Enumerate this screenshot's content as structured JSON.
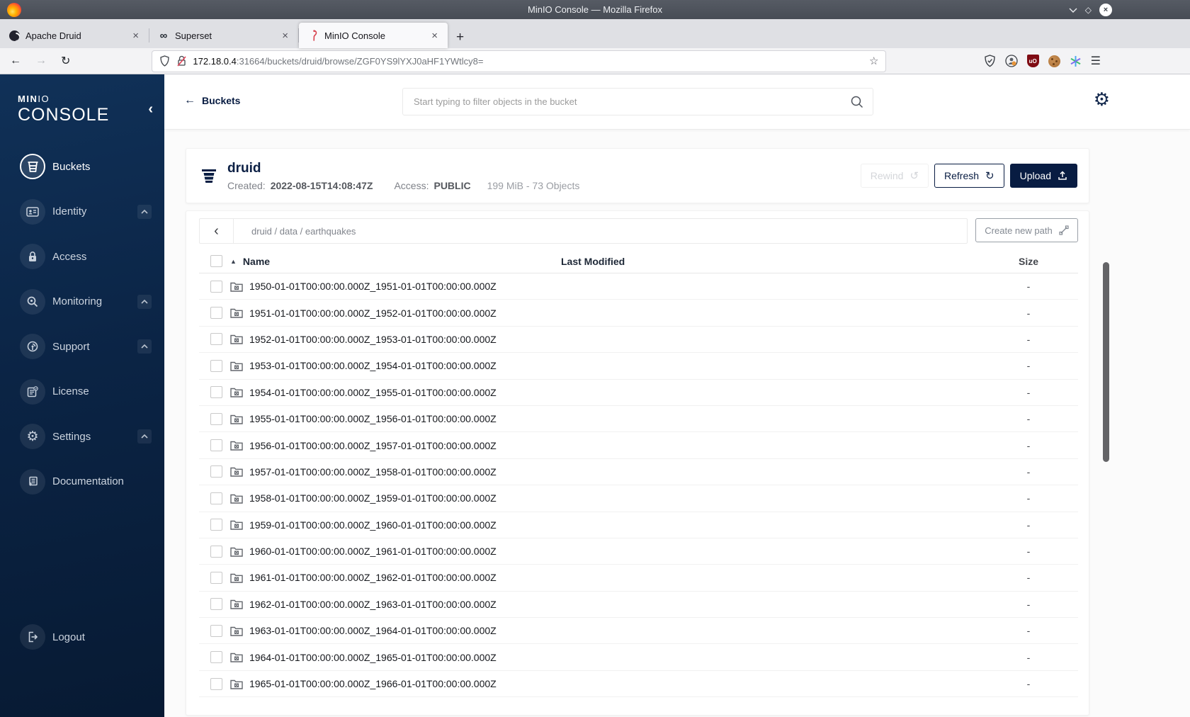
{
  "browser": {
    "window_title": "MinIO Console — Mozilla Firefox",
    "tabs": [
      {
        "label": "Apache Druid"
      },
      {
        "label": "Superset"
      },
      {
        "label": "MinIO Console"
      }
    ],
    "url_host": "172.18.0.4",
    "url_rest": ":31664/buckets/druid/browse/ZGF0YS9lYXJ0aHF1YWtlcy8="
  },
  "icons": {
    "close": "×",
    "maximize": "◇",
    "back_arrow": "←",
    "forward_arrow": "→",
    "reload": "↻",
    "star": "☆",
    "menu": "☰",
    "infinity": "∞",
    "new_tab": "+",
    "chevron_left": "‹",
    "gear": "⚙",
    "sort_asc": "▲",
    "refresh": "↻",
    "rewind": "↺"
  },
  "sidebar": {
    "logo_min": "MIN",
    "logo_io": "IO",
    "logo_console": "CONSOLE",
    "items": [
      {
        "label": "Buckets"
      },
      {
        "label": "Identity"
      },
      {
        "label": "Access"
      },
      {
        "label": "Monitoring"
      },
      {
        "label": "Support"
      },
      {
        "label": "License"
      },
      {
        "label": "Settings"
      },
      {
        "label": "Documentation"
      }
    ],
    "logout_label": "Logout"
  },
  "header": {
    "back_label": "Buckets",
    "search_placeholder": "Start typing to filter objects in the bucket"
  },
  "bucket": {
    "name": "druid",
    "created_label": "Created:",
    "created_value": "2022-08-15T14:08:47Z",
    "access_label": "Access:",
    "access_value": "PUBLIC",
    "usage": "199 MiB - 73 Objects",
    "rewind_label": "Rewind",
    "refresh_label": "Refresh",
    "upload_label": "Upload"
  },
  "browse": {
    "breadcrumb": "druid / data / earthquakes",
    "create_path_label": "Create new path"
  },
  "table": {
    "headers": {
      "name": "Name",
      "last_modified": "Last Modified",
      "size": "Size"
    },
    "rows": [
      {
        "name": "1950-01-01T00:00:00.000Z_1951-01-01T00:00:00.000Z",
        "size": "-"
      },
      {
        "name": "1951-01-01T00:00:00.000Z_1952-01-01T00:00:00.000Z",
        "size": "-"
      },
      {
        "name": "1952-01-01T00:00:00.000Z_1953-01-01T00:00:00.000Z",
        "size": "-"
      },
      {
        "name": "1953-01-01T00:00:00.000Z_1954-01-01T00:00:00.000Z",
        "size": "-"
      },
      {
        "name": "1954-01-01T00:00:00.000Z_1955-01-01T00:00:00.000Z",
        "size": "-"
      },
      {
        "name": "1955-01-01T00:00:00.000Z_1956-01-01T00:00:00.000Z",
        "size": "-"
      },
      {
        "name": "1956-01-01T00:00:00.000Z_1957-01-01T00:00:00.000Z",
        "size": "-"
      },
      {
        "name": "1957-01-01T00:00:00.000Z_1958-01-01T00:00:00.000Z",
        "size": "-"
      },
      {
        "name": "1958-01-01T00:00:00.000Z_1959-01-01T00:00:00.000Z",
        "size": "-"
      },
      {
        "name": "1959-01-01T00:00:00.000Z_1960-01-01T00:00:00.000Z",
        "size": "-"
      },
      {
        "name": "1960-01-01T00:00:00.000Z_1961-01-01T00:00:00.000Z",
        "size": "-"
      },
      {
        "name": "1961-01-01T00:00:00.000Z_1962-01-01T00:00:00.000Z",
        "size": "-"
      },
      {
        "name": "1962-01-01T00:00:00.000Z_1963-01-01T00:00:00.000Z",
        "size": "-"
      },
      {
        "name": "1963-01-01T00:00:00.000Z_1964-01-01T00:00:00.000Z",
        "size": "-"
      },
      {
        "name": "1964-01-01T00:00:00.000Z_1965-01-01T00:00:00.000Z",
        "size": "-"
      },
      {
        "name": "1965-01-01T00:00:00.000Z_1966-01-01T00:00:00.000Z",
        "size": "-"
      }
    ]
  },
  "colors": {
    "accent_navy": "#081C42",
    "sidebar_top": "#103158",
    "sidebar_bottom": "#071a33",
    "titlebar": "#4c515a",
    "ublock_red": "#7f0c14",
    "page_bg": "#fbfbfb"
  }
}
